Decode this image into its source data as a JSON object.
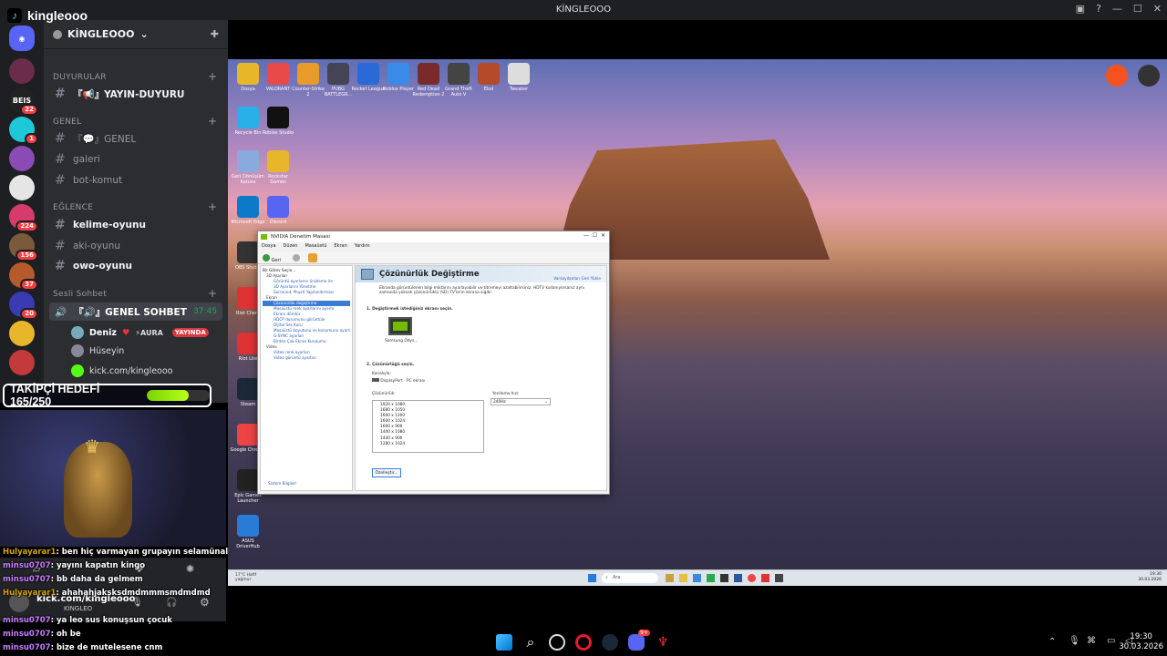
{
  "window": {
    "title": "KİNGLEOOO"
  },
  "channel_brand": {
    "name": "kingleooo"
  },
  "server": {
    "name": "KİNGLEOOO",
    "categories": [
      {
        "label": "DUYURULAR"
      },
      {
        "label": "GENEL"
      },
      {
        "label": "EĞLENCE"
      },
      {
        "label": "Sesli Sohbet"
      }
    ],
    "channels": {
      "yayin_duyuru": "『📢』YAYIN-DUYURU",
      "genel": "『💬』GENEL",
      "galeri": "galeri",
      "bot_komut": "bot-komut",
      "kelime_oyunu": "kelime-oyunu",
      "aki_oyunu": "aki-oyunu",
      "owo_oyunu": "owo-oyunu",
      "genel_sohbet": "『🔊』GENEL SOHBET",
      "genel_sohbet_time": "37:45"
    },
    "voice_users": [
      {
        "name": "Deniz",
        "badge": "⚡AURA",
        "live": "YAYINDA"
      },
      {
        "name": "Hüseyin"
      },
      {
        "name": "kick.com/kingleooo"
      }
    ],
    "guild_badges": [
      "22",
      "1",
      "224",
      "156",
      "37",
      "20"
    ],
    "guild_label_beis": "BEIS"
  },
  "overlay": {
    "goal_text": "TAKİPÇİ HEDEFİ 165/250",
    "goal_progress": 0.66
  },
  "user_panel": {
    "name": "kick.com/kingleooo",
    "tag": "KİNGLEO"
  },
  "chat": [
    {
      "user": "Hulyayarar1",
      "text": "ben hiç varmayan grupayın selamünaleykum"
    },
    {
      "user": "minsu0707",
      "text": "yayını kapatın kingo"
    },
    {
      "user": "minsu0707",
      "text": "bb daha da gelmem"
    },
    {
      "user": "Hulyayarar1",
      "text": "ahahahjaksksdmdmmmsmdmdmd"
    },
    {
      "user": "minsu0707",
      "text": "ya leo sus konuşsun çocuk"
    },
    {
      "user": "minsu0707",
      "text": "oh be"
    },
    {
      "user": "minsu0707",
      "text": "bize de mutelesene cnm"
    }
  ],
  "nvidia": {
    "title": "NVIDIA Denetim Masası",
    "menu": [
      "Dosya",
      "Düzen",
      "Masaüstü",
      "Ekran",
      "Yardım"
    ],
    "back": "Geri",
    "task_label": "Bir Görev Seçin...",
    "tree": [
      "3D Ayarları",
      "Görüntü ayarlarını önizleme ile",
      "3D Ayarlarını Yönetme",
      "Surround, PhysX Yapılandırması",
      "Ekran",
      "Çözünürlük değiştirme",
      "Masaüstü renk ayarlarını ayarla",
      "Ekranı döndür",
      "HDCP durumunu görüntüle",
      "Dijital Ses Kuru",
      "Masaüstü boyutunu ve konumunu ayarla",
      "G-SYNC ayarları",
      "Birden Çok Ekran Kurulumu",
      "Video",
      "Video renk ayarları",
      "Video görüntü ayarları"
    ],
    "heading": "Çözünürlük Değiştirme",
    "defaults_link": "Varsayılanları Geri Yükle",
    "intro": "Ekranda görüntülenen bilgi miktarını ayarlayabilir ve titremeyi azaltabilirsiniz. HDTV kullanıyorsanız aynı zamanda yüksek çözünürlüklü (SD) TV'lerin ekrana sığdır.",
    "step1": "1. Değiştirmek istediğiniz ekranı seçin.",
    "monitor_label": "Samsung Odys...",
    "step2": "2. Çözünürlüğü seçin.",
    "connection_label": "Kanalıyla:",
    "connection_value": "DisplayPort - PC ekranı",
    "resolution_label": "Çözünürlük:",
    "resolutions": [
      "1920 x 1080",
      "1680 x 1050",
      "1600 x 1200",
      "1600 x 1024",
      "1600 x 900",
      "1440 x 1080",
      "1440 x 900",
      "1280 x 1024"
    ],
    "refresh_label": "Yenileme hızı:",
    "refresh_value": "240Hz",
    "customize": "Özelleştir...",
    "sysinfo": "Sistem Bilgileri"
  },
  "desktop_icons": [
    "Dosya",
    "VALORANT",
    "Counter-Strike 2",
    "PUBG BATTLEGR...",
    "Rocket League",
    "Roblox Player",
    "Red Dead Redemption 2",
    "Grand Theft Auto V",
    "Ekol",
    "Tweaker",
    "Recycle Bin",
    "Roblox Studio",
    "Geri Dönüşüm Kutusu",
    "Rockstar Games",
    "Microsoft Edge",
    "Discord",
    "Riot Client",
    "OBS Studio",
    "Riot Lite",
    "Steam",
    "Google Chrome",
    "Epic Games Launcher",
    "ASUS DriverHub"
  ],
  "inner_taskbar": {
    "search": "Ara",
    "weather": "17°C Hafif yağmur",
    "time": "19:30",
    "date": "30.03.2026"
  },
  "taskbar": {
    "time": "19:30",
    "date": "30.03.2026",
    "discord_badge": "9+"
  }
}
